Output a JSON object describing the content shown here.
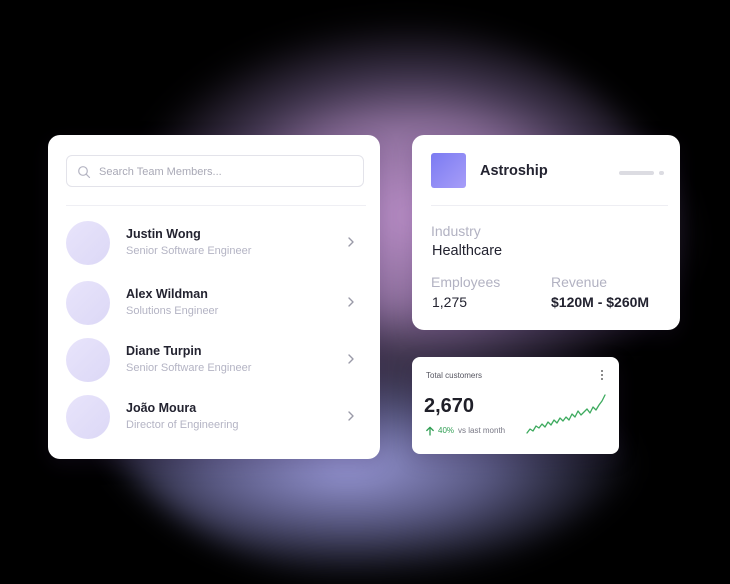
{
  "team": {
    "search_placeholder": "Search Team Members...",
    "members": [
      {
        "name": "Justin Wong",
        "role": "Senior Software Engineer"
      },
      {
        "name": "Alex Wildman",
        "role": "Solutions Engineer"
      },
      {
        "name": "Diane Turpin",
        "role": "Senior Software Engineer"
      },
      {
        "name": "João Moura",
        "role": "Director of Engineering"
      }
    ]
  },
  "company": {
    "name": "Astroship",
    "industry_label": "Industry",
    "industry": "Healthcare",
    "employees_label": "Employees",
    "employees": "1,275",
    "revenue_label": "Revenue",
    "revenue": "$120M - $260M"
  },
  "customers": {
    "title": "Total customers",
    "value": "2,670",
    "trend_pct": "40%",
    "trend_label": "vs last month",
    "trend_color": "#2f9e53"
  },
  "icons": {
    "search": "search-icon",
    "chevron": "chevron-right-icon",
    "more": "more-vertical-icon",
    "trend": "arrow-up-icon"
  }
}
